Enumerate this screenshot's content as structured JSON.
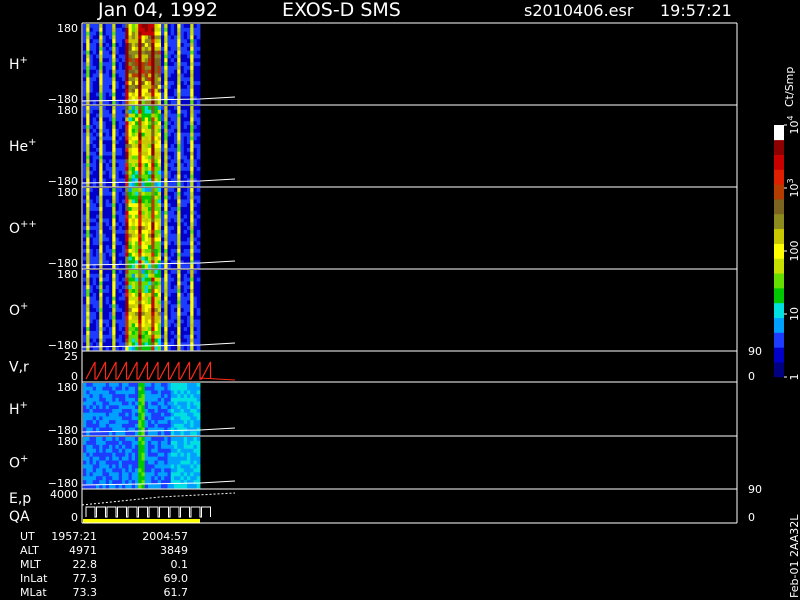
{
  "header": {
    "date": "Jan 04, 1992",
    "instrument": "EXOS-D SMS",
    "file": "s2010406.esr",
    "time": "19:57:21"
  },
  "colors": {
    "background": "#000000",
    "axes": "#ffffff",
    "velocity_trace": "#ff2a1a",
    "qa_bar": "#ffff00",
    "spectrogram_fill": "#0a1e96"
  },
  "chart_data": {
    "type": "heatmap",
    "panels": [
      {
        "id": "h-plus",
        "label": "H",
        "sup": "+",
        "ymax": "180",
        "ymin": "−180",
        "right": [],
        "trace": "white-rising"
      },
      {
        "id": "he-plus",
        "label": "He",
        "sup": "+",
        "ymax": "180",
        "ymin": "−180",
        "right": [],
        "trace": "white-rising"
      },
      {
        "id": "o-plusplus",
        "label": "O",
        "sup": "++",
        "ymax": "180",
        "ymin": "−180",
        "right": [],
        "trace": "white-rising"
      },
      {
        "id": "o-plus",
        "label": "O",
        "sup": "+",
        "ymax": "180",
        "ymin": "−180",
        "right": [],
        "trace": "white-rising"
      },
      {
        "id": "vr",
        "label": "V,r",
        "sup": "",
        "ymax": "25",
        "ymin": "0",
        "right": [
          "90",
          "0"
        ],
        "trace": "red-sawtooth"
      },
      {
        "id": "h-plus-2",
        "label": "H",
        "sup": "+",
        "ymax": "180",
        "ymin": "−180",
        "right": [],
        "trace": "white-rising"
      },
      {
        "id": "o-plus-2",
        "label": "O",
        "sup": "+",
        "ymax": "180",
        "ymin": "−180",
        "right": [],
        "trace": "white-rising"
      },
      {
        "id": "ep-qa",
        "label": "E,p",
        "label2": "QA",
        "sup": "",
        "ymax": "4000",
        "ymin": "0",
        "right": [
          "90",
          "0"
        ],
        "trace": "white-sawtooth"
      }
    ],
    "colorbar": {
      "units": "Ct/Smp",
      "ticks": [
        {
          "label": "10",
          "sup": "4",
          "level": 1.0
        },
        {
          "label": "10",
          "sup": "3",
          "level": 0.75
        },
        {
          "label": "100",
          "sup": "",
          "level": 0.5
        },
        {
          "label": "10",
          "sup": "",
          "level": 0.25
        },
        {
          "label": "1",
          "sup": "",
          "level": 0.0
        }
      ],
      "colors": [
        "#000080",
        "#0000c8",
        "#1e3cff",
        "#00a0ff",
        "#00e0e0",
        "#00c800",
        "#64e000",
        "#c8e000",
        "#ffff00",
        "#c8c800",
        "#8c8c1e",
        "#7a6420",
        "#b43c00",
        "#e01e00",
        "#c80000",
        "#8c0000",
        "#ffffff"
      ]
    },
    "footer_table": {
      "rows": [
        {
          "name": "UT",
          "v1": "1957:21",
          "v2": "2004:57"
        },
        {
          "name": "ALT",
          "v1": "4971",
          "v2": "3849"
        },
        {
          "name": "MLT",
          "v1": "22.8",
          "v2": "0.1"
        },
        {
          "name": "InLat",
          "v1": "77.3",
          "v2": "69.0"
        },
        {
          "name": "MLat",
          "v1": "73.3",
          "v2": "61.7"
        }
      ]
    },
    "stamp": "Feb-01 2AA32L"
  }
}
